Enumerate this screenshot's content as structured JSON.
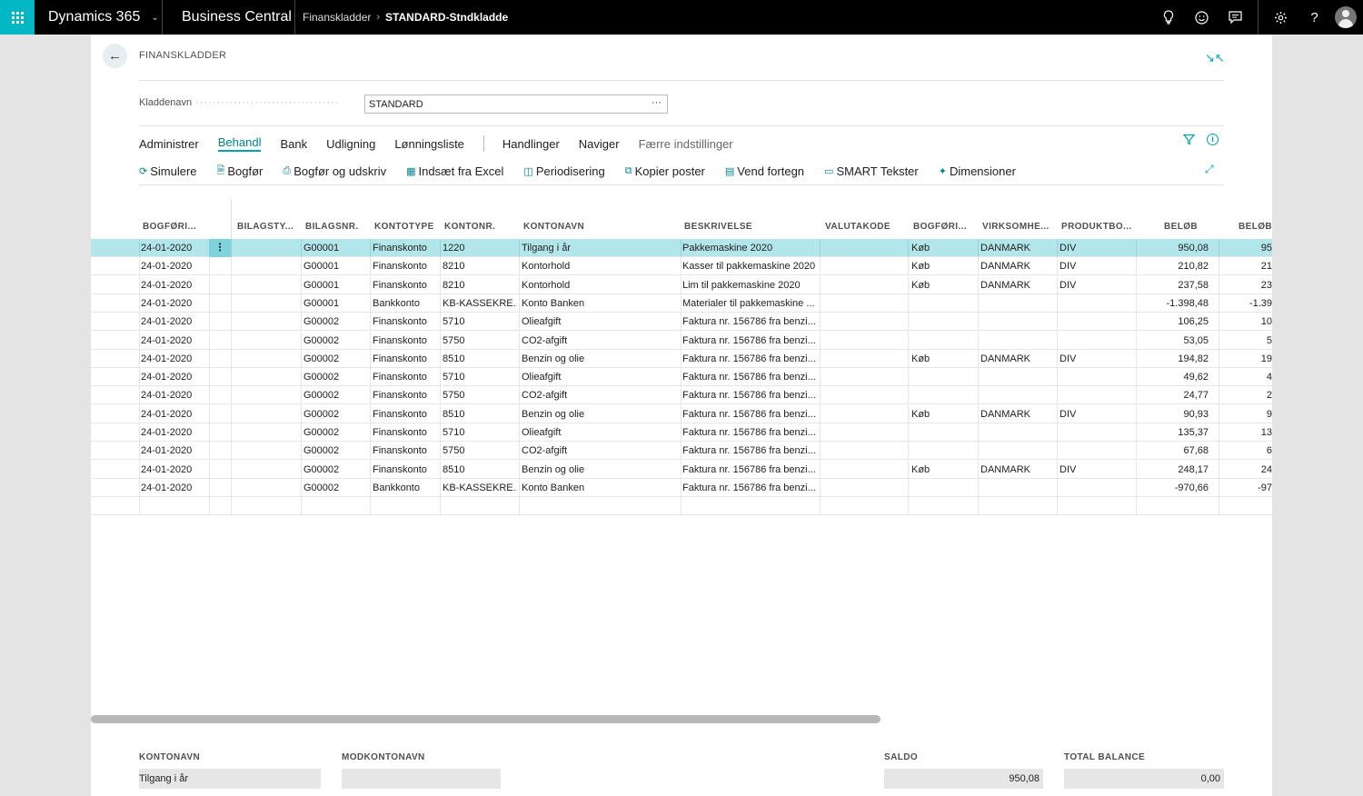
{
  "topbar": {
    "product": "Dynamics 365",
    "app": "Business Central",
    "crumb1": "Finanskladder",
    "crumb2": "STANDARD-Stndkladde"
  },
  "page": {
    "title": "FINANSKLADDER",
    "journal_label": "Kladdenavn",
    "journal_value": "STANDARD",
    "ellipsis": "···"
  },
  "menu": {
    "items": [
      "Administrer",
      "Behandl",
      "Bank",
      "Udligning",
      "Lønningsliste"
    ],
    "items2": [
      "Handlinger",
      "Naviger"
    ],
    "fewer": "Færre indstillinger"
  },
  "actions": [
    "Simulere",
    "Bogfør",
    "Bogfør og udskriv",
    "Indsæt fra Excel",
    "Periodisering",
    "Kopier poster",
    "Vend fortegn",
    "SMART Tekster",
    "Dimensioner"
  ],
  "columns": [
    "BOGFØRI...",
    "BILAGSTY...",
    "BILAGSNR.",
    "KONTOTYPE",
    "KONTONR.",
    "KONTONAVN",
    "BESKRIVELSE",
    "VALUTAKODE",
    "BOGFØRI...",
    "VIRKSOMHE...",
    "PRODUKTBO...",
    "BELØB",
    "BELØB"
  ],
  "rows": [
    [
      "24-01-2020",
      "",
      "G00001",
      "Finanskonto",
      "1220",
      "Tilgang i år",
      "Pakkemaskine 2020",
      "",
      "Køb",
      "DANMARK",
      "DIV",
      "950,08",
      "95"
    ],
    [
      "24-01-2020",
      "",
      "G00001",
      "Finanskonto",
      "8210",
      "Kontorhold",
      "Kasser til pakkemaskine 2020",
      "",
      "Køb",
      "DANMARK",
      "DIV",
      "210,82",
      "21"
    ],
    [
      "24-01-2020",
      "",
      "G00001",
      "Finanskonto",
      "8210",
      "Kontorhold",
      "Lim til pakkemaskine 2020",
      "",
      "Køb",
      "DANMARK",
      "DIV",
      "237,58",
      "23"
    ],
    [
      "24-01-2020",
      "",
      "G00001",
      "Bankkonto",
      "KB-KASSEKRE...",
      "Konto Banken",
      "Materialer til pakkemaskine ...",
      "",
      "",
      "",
      "",
      "-1.398,48",
      "-1.39"
    ],
    [
      "24-01-2020",
      "",
      "G00002",
      "Finanskonto",
      "5710",
      "Olieafgift",
      "Faktura nr. 156786 fra benzi...",
      "",
      "",
      "",
      "",
      "106,25",
      "10"
    ],
    [
      "24-01-2020",
      "",
      "G00002",
      "Finanskonto",
      "5750",
      "CO2-afgift",
      "Faktura nr. 156786 fra benzi...",
      "",
      "",
      "",
      "",
      "53,05",
      "5"
    ],
    [
      "24-01-2020",
      "",
      "G00002",
      "Finanskonto",
      "8510",
      "Benzin og olie",
      "Faktura nr. 156786 fra benzi...",
      "",
      "Køb",
      "DANMARK",
      "DIV",
      "194,82",
      "19"
    ],
    [
      "24-01-2020",
      "",
      "G00002",
      "Finanskonto",
      "5710",
      "Olieafgift",
      "Faktura nr. 156786 fra benzi...",
      "",
      "",
      "",
      "",
      "49,62",
      "4"
    ],
    [
      "24-01-2020",
      "",
      "G00002",
      "Finanskonto",
      "5750",
      "CO2-afgift",
      "Faktura nr. 156786 fra benzi...",
      "",
      "",
      "",
      "",
      "24,77",
      "2"
    ],
    [
      "24-01-2020",
      "",
      "G00002",
      "Finanskonto",
      "8510",
      "Benzin og olie",
      "Faktura nr. 156786 fra benzi...",
      "",
      "Køb",
      "DANMARK",
      "DIV",
      "90,93",
      "9"
    ],
    [
      "24-01-2020",
      "",
      "G00002",
      "Finanskonto",
      "5710",
      "Olieafgift",
      "Faktura nr. 156786 fra benzi...",
      "",
      "",
      "",
      "",
      "135,37",
      "13"
    ],
    [
      "24-01-2020",
      "",
      "G00002",
      "Finanskonto",
      "5750",
      "CO2-afgift",
      "Faktura nr. 156786 fra benzi...",
      "",
      "",
      "",
      "",
      "67,68",
      "6"
    ],
    [
      "24-01-2020",
      "",
      "G00002",
      "Finanskonto",
      "8510",
      "Benzin og olie",
      "Faktura nr. 156786 fra benzi...",
      "",
      "Køb",
      "DANMARK",
      "DIV",
      "248,17",
      "24"
    ],
    [
      "24-01-2020",
      "",
      "G00002",
      "Bankkonto",
      "KB-KASSEKRE...",
      "Konto Banken",
      "Faktura nr. 156786 fra benzi...",
      "",
      "",
      "",
      "",
      "-970,66",
      "-97"
    ],
    [
      "",
      "",
      "",
      "",
      "",
      "",
      "",
      "",
      "",
      "",
      "",
      "",
      ""
    ]
  ],
  "footer": {
    "kontonavn_label": "KONTONAVN",
    "kontonavn_value": "Tilgang i år",
    "modkontonavn_label": "MODKONTONAVN",
    "modkontonavn_value": "",
    "saldo_label": "SALDO",
    "saldo_value": "950,08",
    "total_label": "TOTAL BALANCE",
    "total_value": "0,00"
  },
  "colors": {
    "accent": "#00a2ad",
    "selected_row": "#b3e6ea",
    "waffle": "#00b7c3"
  }
}
